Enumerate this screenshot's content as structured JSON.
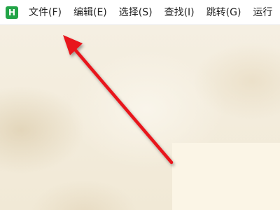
{
  "app": {
    "logo_letter": "H",
    "logo_color": "#22a447"
  },
  "menubar": {
    "items": [
      {
        "label": "文件(F)"
      },
      {
        "label": "编辑(E)"
      },
      {
        "label": "选择(S)"
      },
      {
        "label": "查找(I)"
      },
      {
        "label": "跳转(G)"
      },
      {
        "label": "运行"
      }
    ]
  },
  "annotation": {
    "arrow_color": "#e8121a",
    "points_to": "file-menu"
  }
}
